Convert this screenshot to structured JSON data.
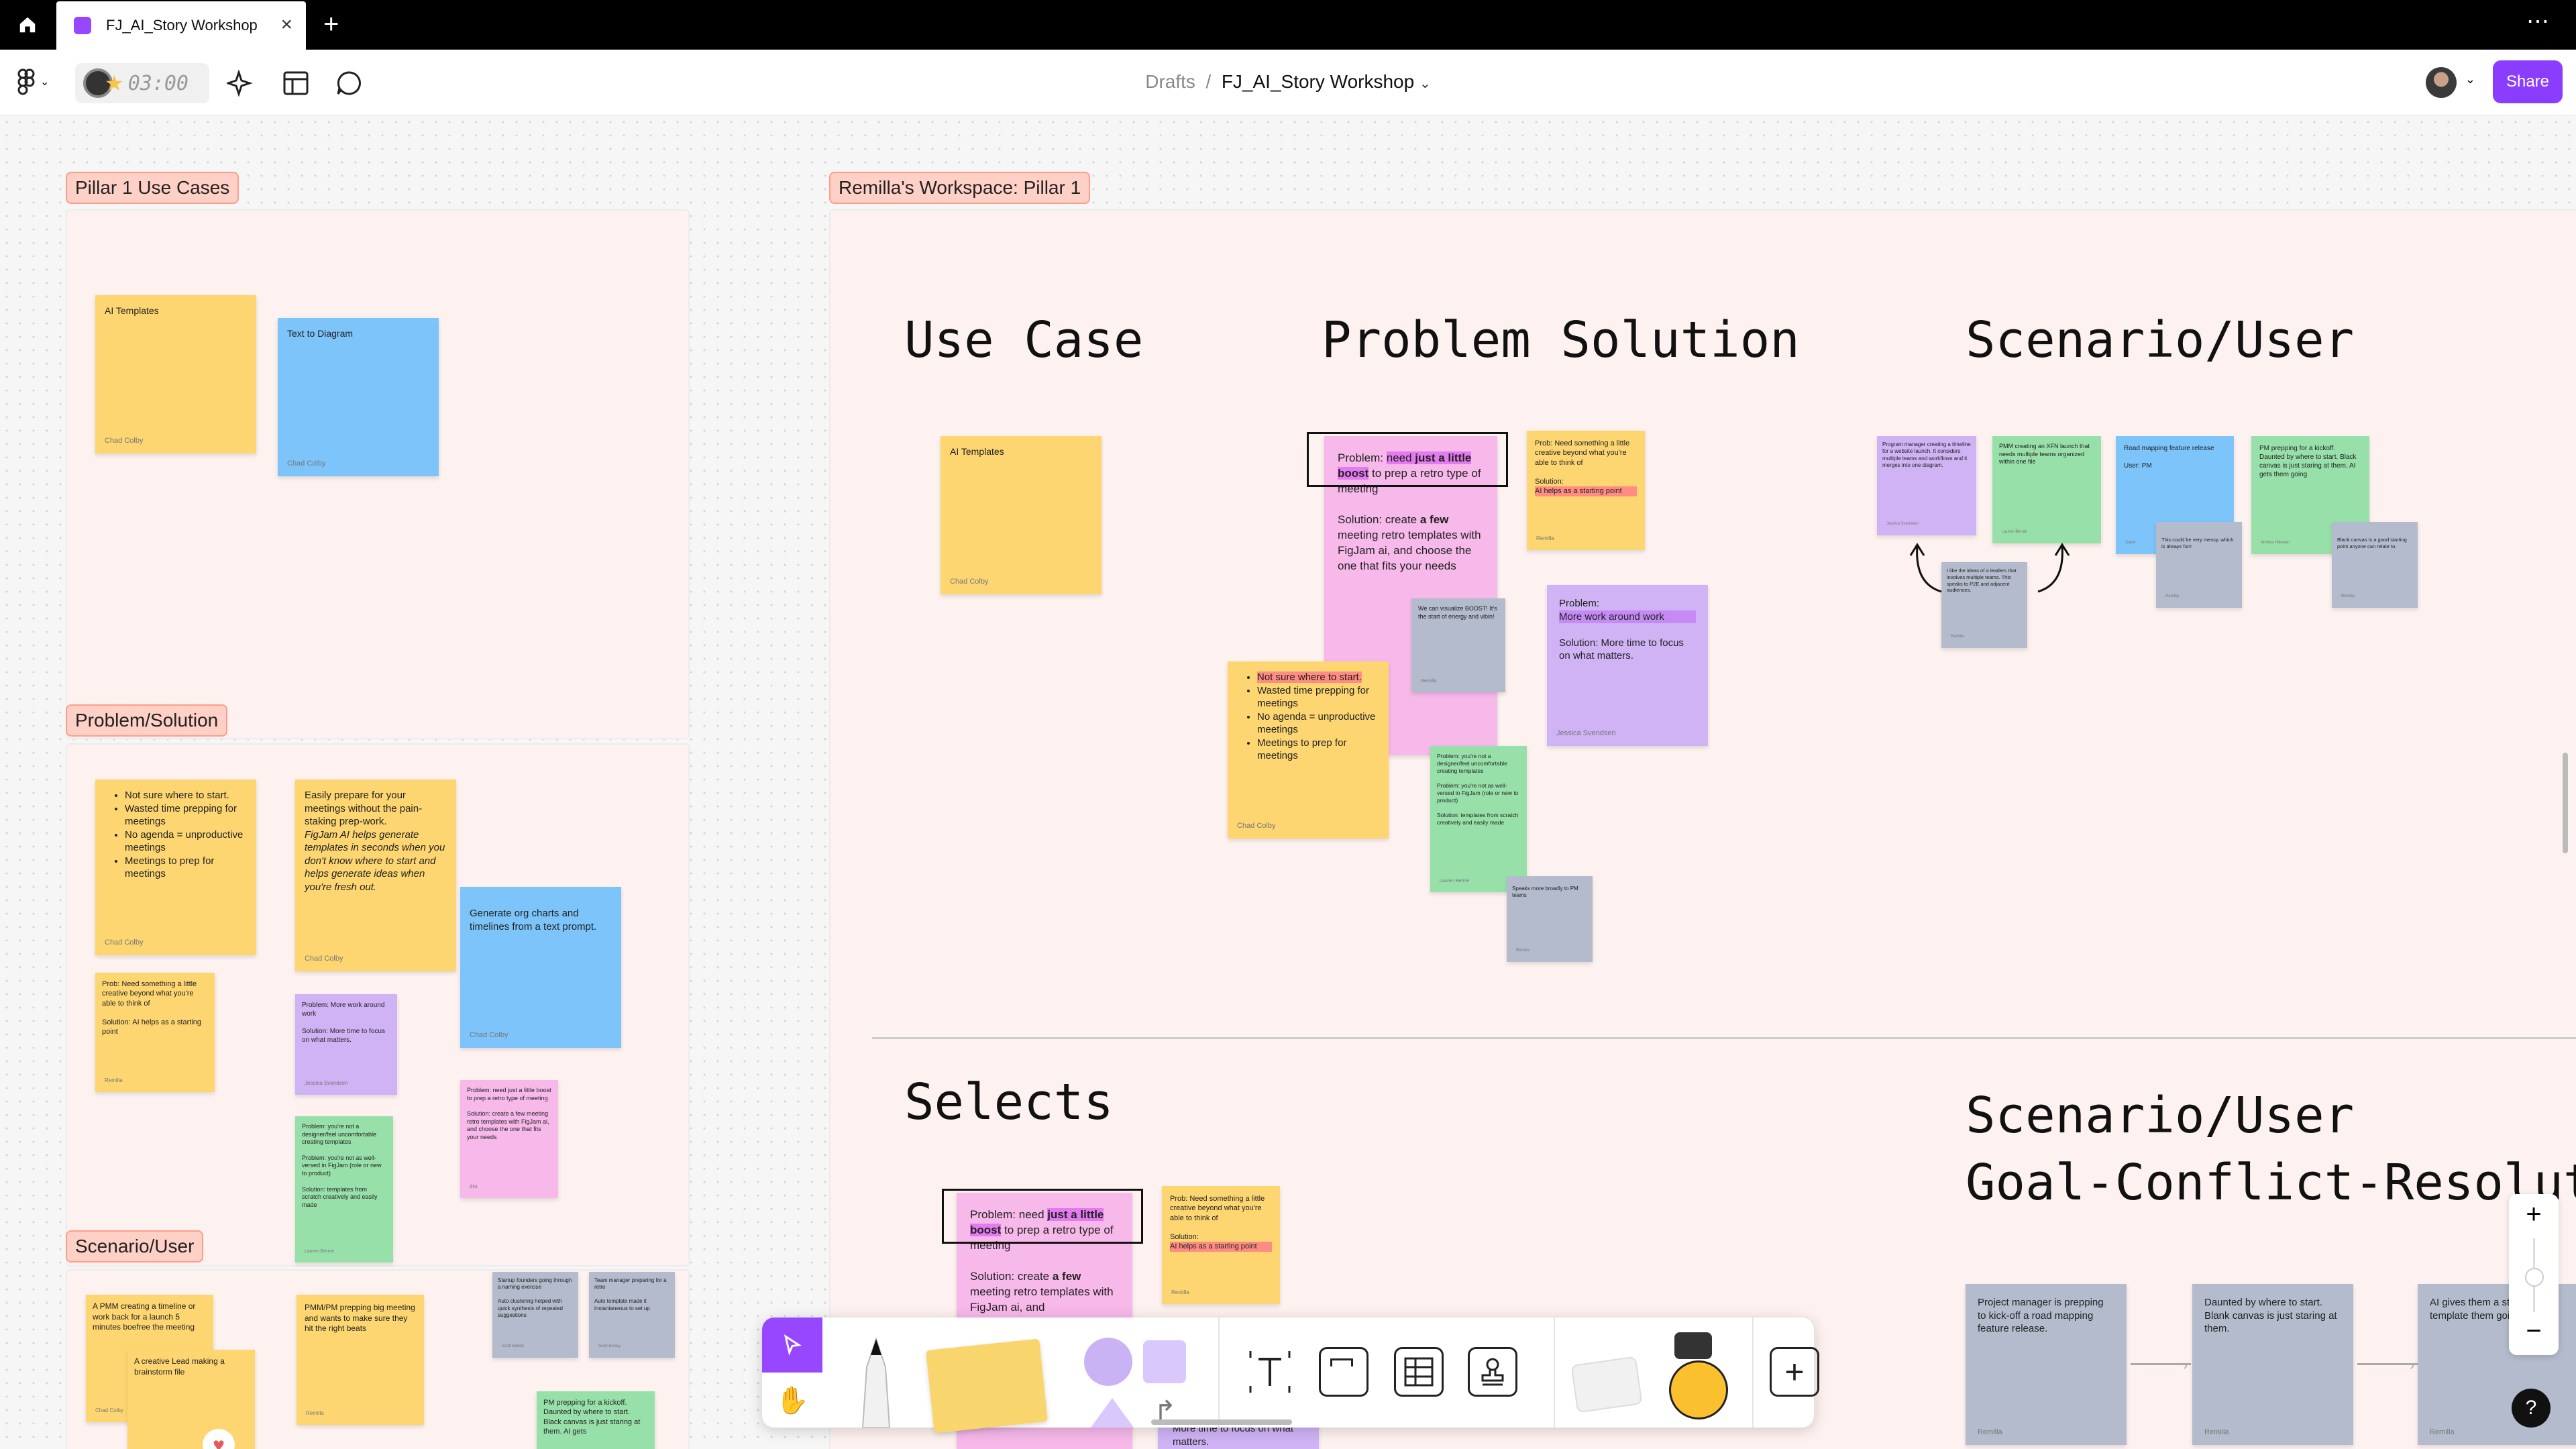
{
  "tab": {
    "title": "FJ_AI_Story Workshop"
  },
  "toolbar": {
    "timer": "03:00",
    "breadcrumb_root": "Drafts",
    "file_name": "FJ_AI_Story Workshop",
    "share": "Share"
  },
  "sections": {
    "pillar1": "Pillar 1 Use Cases",
    "problem_solution": "Problem/Solution",
    "scenario_user": "Scenario/User",
    "workspace": "Remilla's Workspace: Pillar 1"
  },
  "headers": {
    "use_case": "Use Case",
    "problem_solution": "Problem Solution",
    "scenario_user": "Scenario/User",
    "selects": "Selects",
    "scenario_user2": "Scenario/User",
    "goal": "Goal-Conflict-Resoluti"
  },
  "left": {
    "ai_templates": {
      "text": "AI Templates",
      "author": "Chad Colby"
    },
    "text_to_diagram": {
      "text": "Text to Diagram",
      "author": "Chad Colby"
    },
    "notsure": {
      "items": [
        "Not sure where to start.",
        "Wasted time prepping for meetings",
        "No agenda = unproductive meetings",
        "Meetings to prep for meetings"
      ],
      "author": "Chad Colby"
    },
    "easily": {
      "t1": "Easily prepare for your meetings without the pain-staking prep-work.",
      "t2": "FigJam AI helps generate templates in seconds when you don't know where to start and helps generate ideas when you're fresh out.",
      "author": "Chad Colby"
    },
    "generate_org": {
      "text": "Generate org charts and timelines from a text prompt.",
      "author": "Chad Colby"
    },
    "prob_need": {
      "text": "Prob: Need something a little creative beyond what you're able to think of",
      "sol": "Solution: AI helps as a starting point",
      "author": "Remilla"
    },
    "prob_more": {
      "text": "Problem: More work around work",
      "sol": "Solution: More time to focus on what matters.",
      "author": "Jessica Svendsen"
    },
    "prob_retro": {
      "text": "Problem: need just a little boost to prep a retro type of meeting",
      "sol": "Solution: create a few meeting retro templates with FigJam ai, and choose the one that fits your needs",
      "author": "dro"
    },
    "green": {
      "text": "Problem: you're not a designer/feel uncomfortable creating templates",
      "t2": "Problem: you're not as well-versed in FigJam (role or new to product)",
      "sol": "Solution: templates from scratch creatively and easily made",
      "author": "Lauren Bernie"
    },
    "pmm_timeline": {
      "text": "A PMM creating a timeline or work back for a launch 5 minutes boefree the meeting",
      "author": "Chad Colby"
    },
    "creative_lead": {
      "text": "A creative Lead making a brainstorm file"
    },
    "pmm_prep": {
      "text": "PMM/PM prepping big meeting and wants to make sure they hit the right beats",
      "author": "Remilla"
    },
    "startup": {
      "text": "Startup founders going through a naming exercise",
      "t2": "Auto clustering helped with quick synthesis of repeated suggestions",
      "author": "Scott Belsky"
    },
    "team_mgr": {
      "text": "Team manager preparing for a retro",
      "t2": "Auto template made it instantaneous to set up",
      "author": "Scott Belsky"
    },
    "pm_kickoff": {
      "text": "PM prepping for a kickoff. Daunted by where to start. Black canvas is just staring at them. AI gets"
    }
  },
  "workspace": {
    "ai_templates": {
      "text": "AI Templates",
      "author": "Chad Colby"
    },
    "retro": {
      "p1": "Problem: ",
      "p2": "need ",
      "p3": "just a little boost",
      "p4": " to prep a retro type of meeting",
      "sol_a": "Solution: create ",
      "sol_b": "a few",
      "sol_c": " meeting retro templates with FigJam ai, and choose the one that fits your needs",
      "author": "dro"
    },
    "need_creative": {
      "text": "Prob: Need something a little creative beyond what you're able to think of",
      "sol": "Solution:",
      "hl": "AI helps as a starting point",
      "author": "Remilla"
    },
    "boost": {
      "text": "We can visualize BOOST! It's the start of energy and vibin!",
      "author": "Remilla"
    },
    "more_work": {
      "p": "Problem:",
      "hl": "More work around work",
      "sol": "Solution: More time to focus on what matters.",
      "author": "Jessica Svendsen"
    },
    "notsure": {
      "hl1": "Not sure where to start.",
      "items": [
        "Wasted time prepping for meetings",
        "No agenda = unproductive meetings",
        "Meetings to prep for meetings"
      ],
      "author": "Chad Colby"
    },
    "green": {
      "text": "Problem: you're not a designer/feel uncomfortable creating templates",
      "t2": "Problem: you're not as well-versed in FigJam (role or new to product)",
      "sol": "Solution: templates from scratch creatively and easily made",
      "author": "Lauren Bernie"
    },
    "speaks": {
      "text": "Speaks more broadly to PM teams",
      "author": "Remilla"
    },
    "program_mgr": {
      "text": "Program manager creating a timeline for a website launch. It considers multiple teams and workflows and it merges into one diagram.",
      "author": "Jessica Svendsen"
    },
    "pmm_xfn": {
      "text": "PMM creating an XFN launch that needs multiple teams organized within one file",
      "author": "Lauren Bernie"
    },
    "road_map": {
      "text": "Road mapping feature release",
      "user": "User: PM",
      "author": "Super"
    },
    "pm_kickoff": {
      "text": "PM prepping for a kickoff. Daunted by where to start. Black canvas is just staring at them. AI gets them going",
      "author": "Andrea Hileman"
    },
    "like_ideas": {
      "text": "I like the ideas of a leaders that involves multiple teams. This speaks to P2E and adjacent audiences.",
      "author": "Remilla"
    },
    "could_messy": {
      "text": "This could be very messy, which is always fun!",
      "author": "Remilla"
    },
    "blank_canvas": {
      "text": "Blank canvas is a good starting point anyone can relate to.",
      "author": "Remilla"
    },
    "sel_retro": {
      "p1": "Problem: need ",
      "p3": "just a little boost",
      "p4": " to prep a retro type of meeting",
      "sol_a": "Solution: create ",
      "sol_b": "a few",
      "sol_c": " meeting retro templates with FigJam ai, and"
    },
    "sel_need": {
      "text": "Prob: Need something a little creative beyond what you're able to think of",
      "sol": "Solution:",
      "hl": "AI helps as a starting point",
      "author": "Remilla"
    },
    "more_time": {
      "text": "More time to focus on what matters."
    },
    "g1": {
      "text": "Project manager is prepping to kick-off a road mapping feature release.",
      "author": "Remilla"
    },
    "g2": {
      "text": "Daunted by where to start. Blank canvas is just staring at them.",
      "author": "Remilla"
    },
    "g3": {
      "text": "AI gives them a st with a template them going.",
      "author": "Remilla"
    }
  },
  "zoom": {
    "plus": "+",
    "minus": "−"
  },
  "help": "?"
}
